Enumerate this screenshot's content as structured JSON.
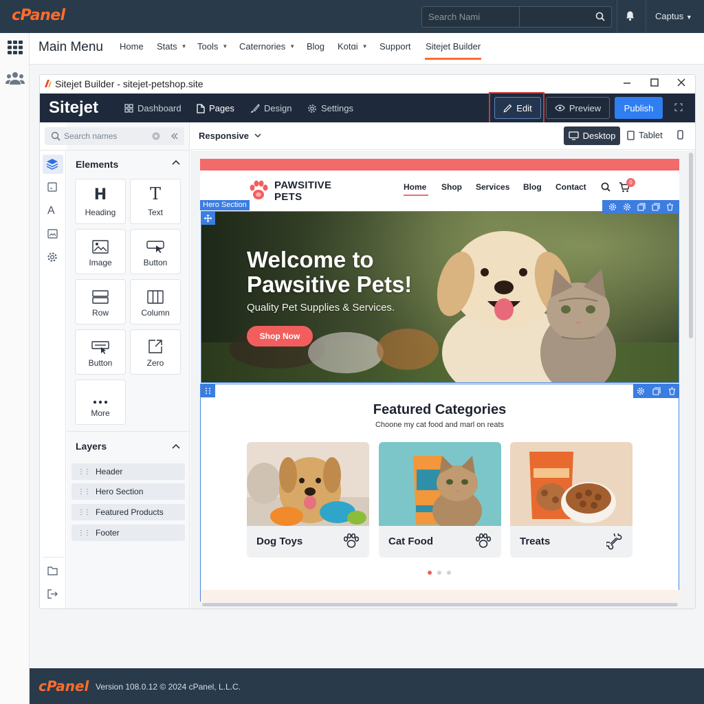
{
  "cpanel": {
    "logo": "cPanel",
    "search_placeholder": "Search Nami",
    "user_label": "Captus",
    "menu_title": "Main Menu",
    "nav": [
      {
        "label": "Home",
        "dropdown": false
      },
      {
        "label": "Stats",
        "dropdown": true
      },
      {
        "label": "Tools",
        "dropdown": true
      },
      {
        "label": "Caternories",
        "dropdown": true
      },
      {
        "label": "Blog",
        "dropdown": false
      },
      {
        "label": "Kotɑi",
        "dropdown": true
      },
      {
        "label": "Support",
        "dropdown": false
      },
      {
        "label": "Sitejet Builder",
        "dropdown": false,
        "active": true
      }
    ],
    "footer_logo": "cPanel",
    "footer_version": "Version 108.0.12 © 2024 cPanel, L.L.C.",
    "accent_color": "#ff6c2c"
  },
  "window": {
    "title": "Sitejet Builder - sitejet-petshop.site"
  },
  "sitejet": {
    "logo": "Sitejet",
    "tabs": [
      {
        "label": "Dashboard",
        "icon": "dashboard-icon"
      },
      {
        "label": "Pages",
        "icon": "page-icon",
        "active": true
      },
      {
        "label": "Design",
        "icon": "brush-icon"
      },
      {
        "label": "Settings",
        "icon": "gear-icon"
      }
    ],
    "edit_label": "Edit",
    "preview_label": "Preview",
    "publish_label": "Publish",
    "publish_color": "#2f7ef2"
  },
  "panel": {
    "search_placeholder": "Search names",
    "elements_title": "Elements",
    "elements": [
      {
        "label": "Heading",
        "icon": "heading-icon"
      },
      {
        "label": "Text",
        "icon": "text-icon"
      },
      {
        "label": "Image",
        "icon": "image-icon"
      },
      {
        "label": "Button",
        "icon": "button-icon"
      },
      {
        "label": "Row",
        "icon": "row-icon"
      },
      {
        "label": "Column",
        "icon": "column-icon"
      },
      {
        "label": "Button",
        "icon": "button-alt-icon"
      },
      {
        "label": "Zero",
        "icon": "zero-icon"
      },
      {
        "label": "More",
        "icon": "more-icon"
      }
    ],
    "layers_title": "Layers",
    "layers": [
      "Header",
      "Hero Section",
      "Featured Products",
      "Footer"
    ]
  },
  "canvas": {
    "responsive_label": "Responsive",
    "desktop_label": "Desktop",
    "tablet_label": "Tablet"
  },
  "site": {
    "logo_line1": "PAWSITIVE",
    "logo_line2": "PETS",
    "nav": [
      "Home",
      "Shop",
      "Services",
      "Blog",
      "Contact"
    ],
    "cart_count": "0",
    "hero_label": "Hero Section",
    "hero_title": "Welcome to Pawsitive Pets!",
    "hero_subtitle": "Quality Pet Supplies & Services.",
    "hero_button": "Shop Now",
    "featured_title": "Featured Categories",
    "featured_subtitle": "Choone my cat food and marl on reats",
    "categories": [
      {
        "name": "Dog Toys",
        "icon": "paw-icon"
      },
      {
        "name": "Cat Food",
        "icon": "paw-icon"
      },
      {
        "name": "Treats",
        "icon": "bone-icon"
      }
    ],
    "carousel_active_index": 0,
    "carousel_count": 3,
    "brand_color": "#f26a6a"
  }
}
